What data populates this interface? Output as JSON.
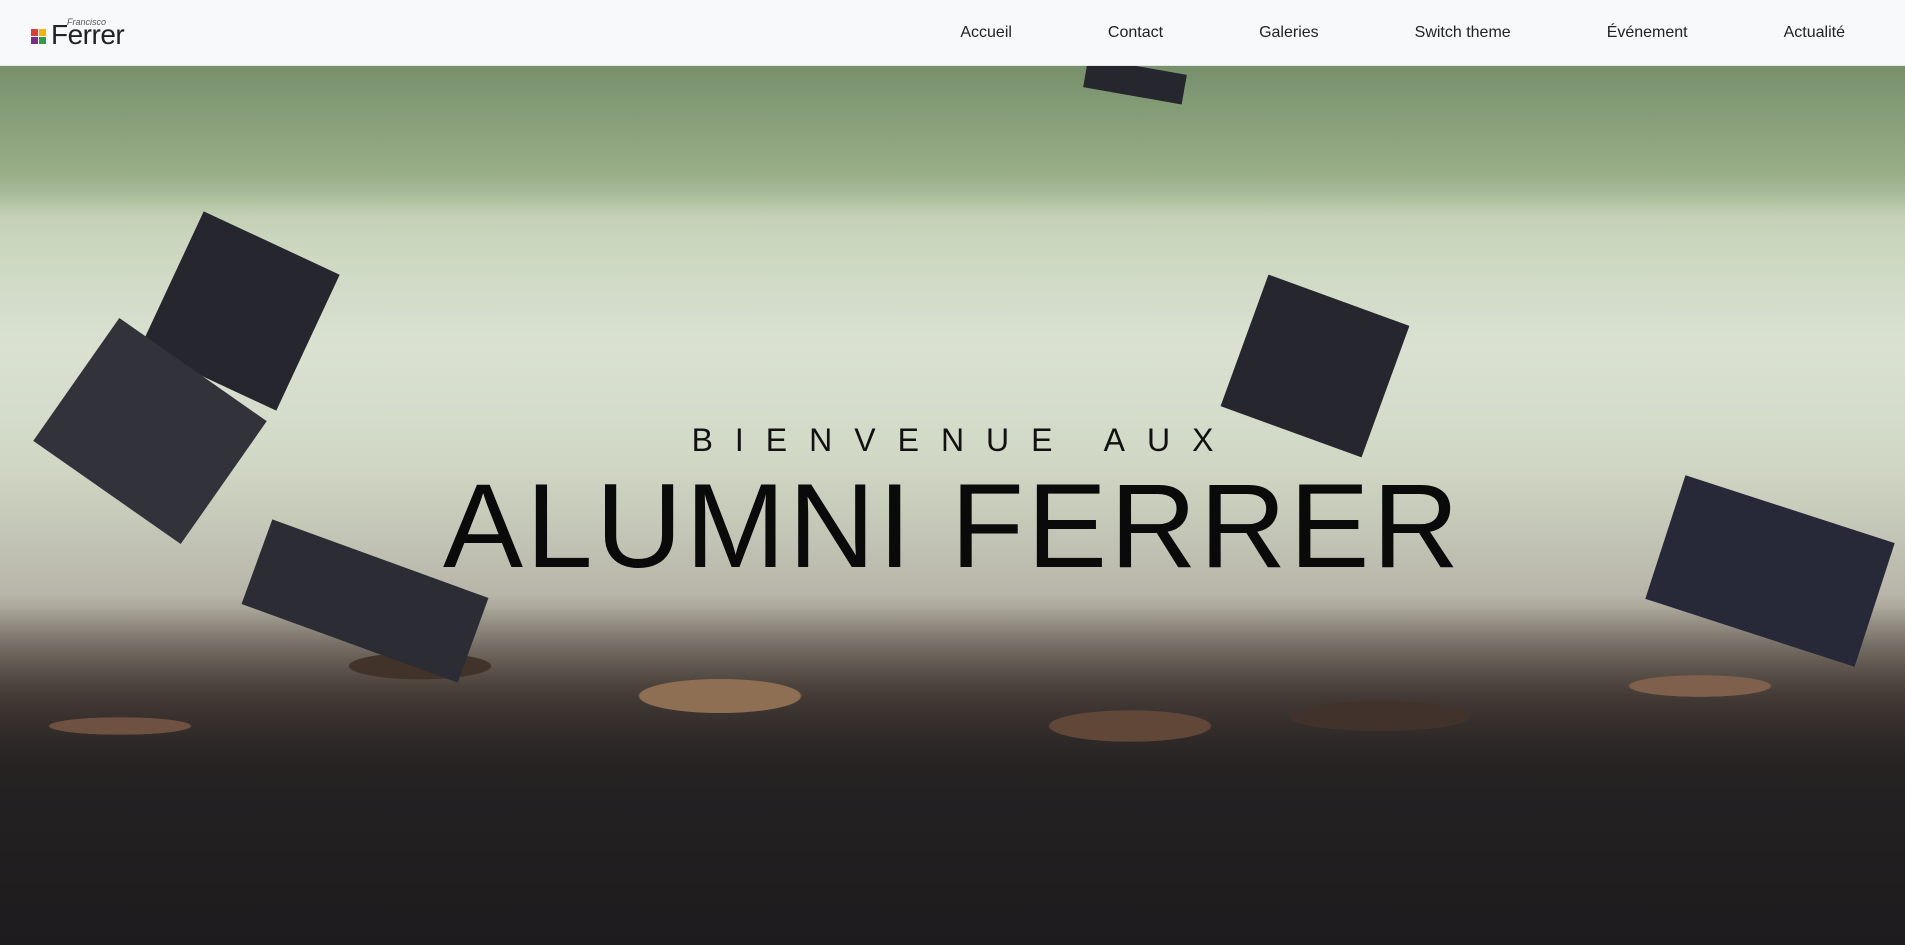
{
  "brand": {
    "small_text": "Francisco",
    "name": "Ferrer"
  },
  "nav": {
    "items": [
      {
        "label": "Accueil"
      },
      {
        "label": "Contact"
      },
      {
        "label": "Galeries"
      },
      {
        "label": "Switch theme"
      },
      {
        "label": "Événement"
      },
      {
        "label": "Actualité"
      }
    ]
  },
  "hero": {
    "subtitle": "BIENVENUE AUX",
    "title": "ALUMNI FERRER",
    "image": "graduation-caps-thrown-photo"
  },
  "colors": {
    "navbar_bg": "#f8f9fa",
    "text": "#222222"
  }
}
